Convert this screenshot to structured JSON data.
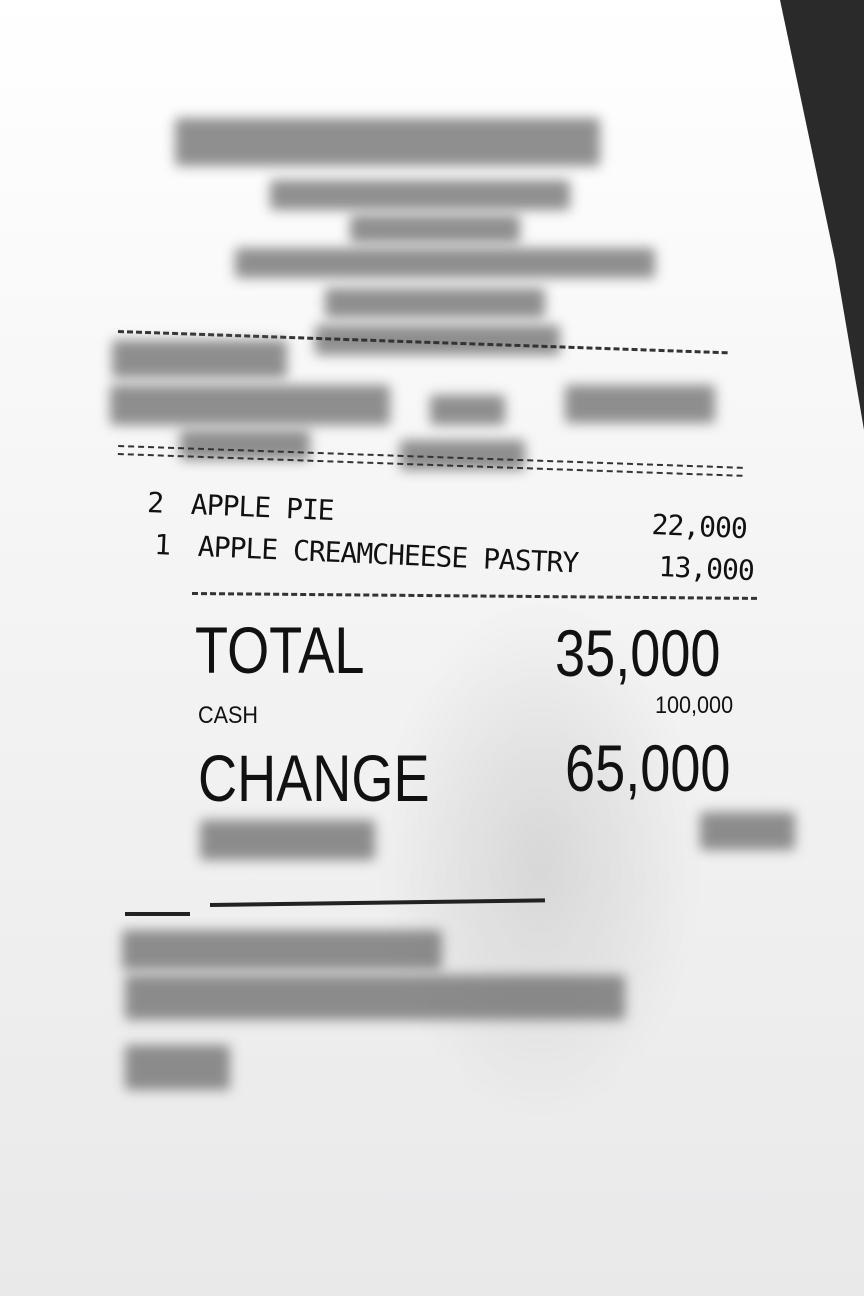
{
  "receipt": {
    "items": [
      {
        "qty": "2",
        "name": "APPLE PIE",
        "price": "22,000"
      },
      {
        "qty": "1",
        "name": "APPLE CREAMCHEESE PASTRY",
        "price": "13,000"
      }
    ],
    "total_label": "TOTAL",
    "total_value": "35,000",
    "cash_label": "CASH",
    "cash_value": "100,000",
    "change_label": "CHANGE",
    "change_value": "65,000"
  }
}
